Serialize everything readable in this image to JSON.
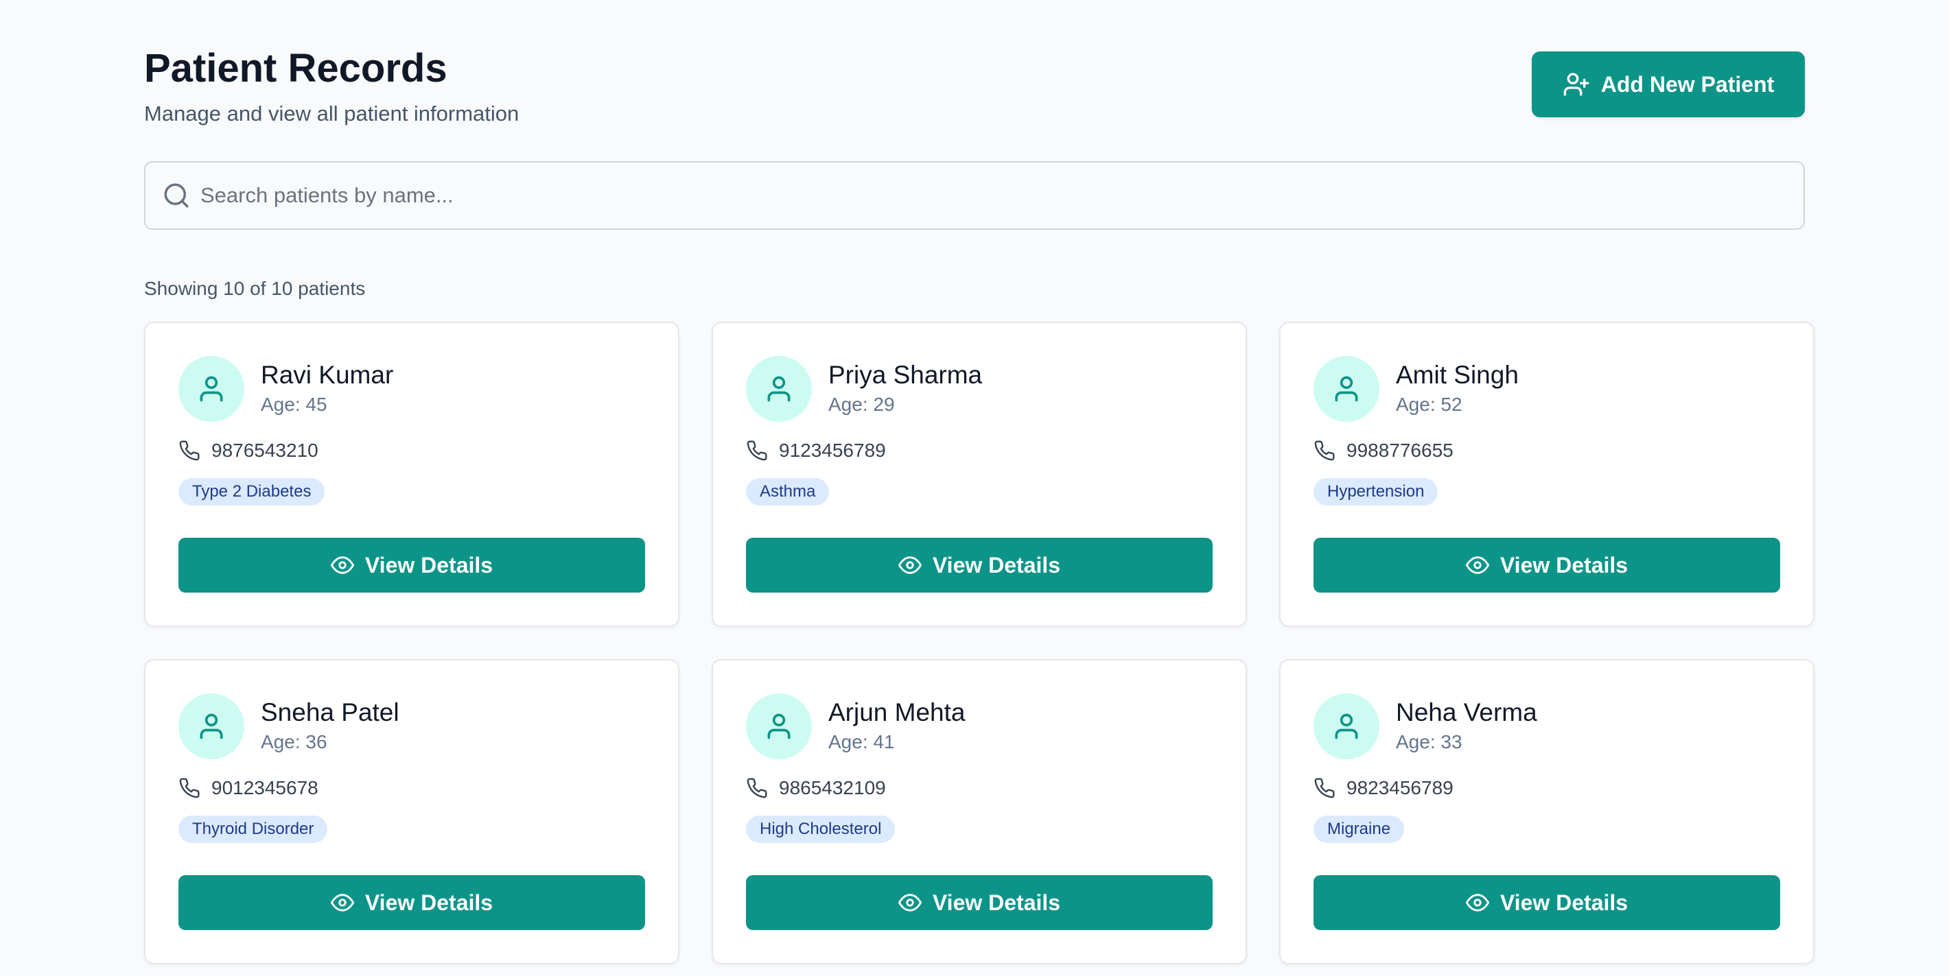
{
  "header": {
    "title": "Patient Records",
    "subtitle": "Manage and view all patient information",
    "add_button_label": "Add New Patient",
    "add_button_icon": "user-plus-icon"
  },
  "search": {
    "placeholder": "Search patients by name...",
    "value": "",
    "icon": "search-icon"
  },
  "summary": {
    "count_text": "Showing 10 of 10 patients"
  },
  "colors": {
    "accent": "#0d9488",
    "avatar_bg": "#ccfbf1",
    "badge_bg": "#dbeafe",
    "badge_text": "#1e3a8a",
    "page_bg": "#f8fafc"
  },
  "patients": [
    {
      "name": "Ravi Kumar",
      "age": "Age: 45",
      "phone": "9876543210",
      "condition": "Type 2 Diabetes",
      "button_label": "View Details"
    },
    {
      "name": "Priya Sharma",
      "age": "Age: 29",
      "phone": "9123456789",
      "condition": "Asthma",
      "button_label": "View Details"
    },
    {
      "name": "Amit Singh",
      "age": "Age: 52",
      "phone": "9988776655",
      "condition": "Hypertension",
      "button_label": "View Details"
    },
    {
      "name": "Sneha Patel",
      "age": "Age: 36",
      "phone": "9012345678",
      "condition": "Thyroid Disorder",
      "button_label": "View Details"
    },
    {
      "name": "Arjun Mehta",
      "age": "Age: 41",
      "phone": "9865432109",
      "condition": "High Cholesterol",
      "button_label": "View Details"
    },
    {
      "name": "Neha Verma",
      "age": "Age: 33",
      "phone": "9823456789",
      "condition": "Migraine",
      "button_label": "View Details"
    }
  ]
}
